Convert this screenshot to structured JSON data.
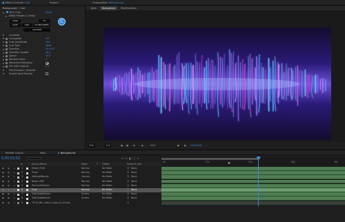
{
  "top_tabs": {
    "effect_controls": "Effect Controls",
    "effect_controls_layer": "Cust",
    "project": "Project",
    "composition": "Composition",
    "composition_name": "Background"
  },
  "effect_controls": {
    "header": "Background • Cust",
    "effect_name": "BCC Cust",
    "reset": "Reset",
    "preset_label": "Effect Presets & Utility",
    "buttons": [
      "LOAD",
      "SAVE",
      "CLIP",
      "FX BROWSER",
      "FX",
      "CUSTOM"
    ],
    "params": [
      {
        "label": "Compute",
        "value": ""
      },
      {
        "label": "Composite",
        "value": "Off"
      },
      {
        "label": "Cust Amplitude",
        "value": "100"
      },
      {
        "label": "Curl Type",
        "value": "Wide"
      },
      {
        "label": "Direction",
        "value": "0x+0.0°"
      },
      {
        "label": "Direction Spread",
        "value": "40.0"
      },
      {
        "label": "Speed",
        "value": "10.0"
      },
      {
        "label": "Random Seed",
        "value": "1"
      },
      {
        "label": "Advanced Sampling",
        "value": ""
      },
      {
        "label": "Mix with Original",
        "value": "0.0"
      },
      {
        "label": "PixelChooser / Shadow",
        "value": ""
      },
      {
        "label": "Enable Host Reactor",
        "value": ""
      }
    ]
  },
  "composition": {
    "tabs": [
      "Back",
      "Background",
      "Mix/Emulation"
    ],
    "zoom": "50%",
    "resolution": "Full",
    "exposure": "+0.0",
    "timecode": "0;00;00;00"
  },
  "timeline": {
    "tabs": [
      "Render Queue",
      "Main",
      "Background"
    ],
    "timecode": "0;00;03;02",
    "columns": [
      "#",
      "Source Name",
      "Mode",
      "T",
      "TrkMat",
      "Parent & Link"
    ],
    "ruler": [
      "0s",
      "02s",
      "04s",
      "06s",
      "08s"
    ],
    "layers": [
      {
        "index": "1",
        "name": "[Mask] Shift",
        "mode": "Normal",
        "trkmat": "No Matte",
        "parent": "None",
        "color": "#c7c7c7",
        "selected": false
      },
      {
        "index": "2",
        "name": "Turbo",
        "mode": "Normal",
        "trkmat": "No Matte",
        "parent": "None",
        "color": "#c7c7c7",
        "selected": false
      },
      {
        "index": "3",
        "name": "SoftLightBorder",
        "mode": "Overlay",
        "trkmat": "No Matte",
        "parent": "None",
        "color": "#c7c7c7",
        "selected": false
      },
      {
        "index": "4",
        "name": "Bright HDR",
        "mode": "Normal",
        "trkmat": "No Matte",
        "parent": "None",
        "color": "#c7c7c7",
        "selected": false
      },
      {
        "index": "5",
        "name": "TextGenMedium",
        "mode": "Normal",
        "trkmat": "No Matte",
        "parent": "None",
        "color": "#c7c7c7",
        "selected": false
      },
      {
        "index": "6",
        "name": "Cust",
        "mode": "Normal",
        "trkmat": "No Matte",
        "parent": "None",
        "color": "#e0e0e0",
        "selected": true
      },
      {
        "index": "7",
        "name": "SoftGlowMedium",
        "mode": "Screen",
        "trkmat": "No Matte",
        "parent": "None",
        "color": "#c7c7c7",
        "selected": false
      },
      {
        "index": "8",
        "name": "SoftGlowMedium",
        "mode": "Screen",
        "trkmat": "No Matte",
        "parent": "None",
        "color": "#c7c7c7",
        "selected": false
      },
      {
        "index": "9",
        "name": "FX1-B_Bkr_Loop1_Loops_D_04.mov",
        "mode": "",
        "trkmat": "",
        "parent": "",
        "color": "#7a7a7a",
        "selected": false
      }
    ]
  },
  "colors": {
    "accent_blue": "#3d87e0",
    "track_green": "#4e7d52",
    "track_selected": "#6c9d6f",
    "viewer_bg": "#150c2e",
    "glow_cyan": "#6fd6ff",
    "glow_magenta": "#c042e0"
  }
}
